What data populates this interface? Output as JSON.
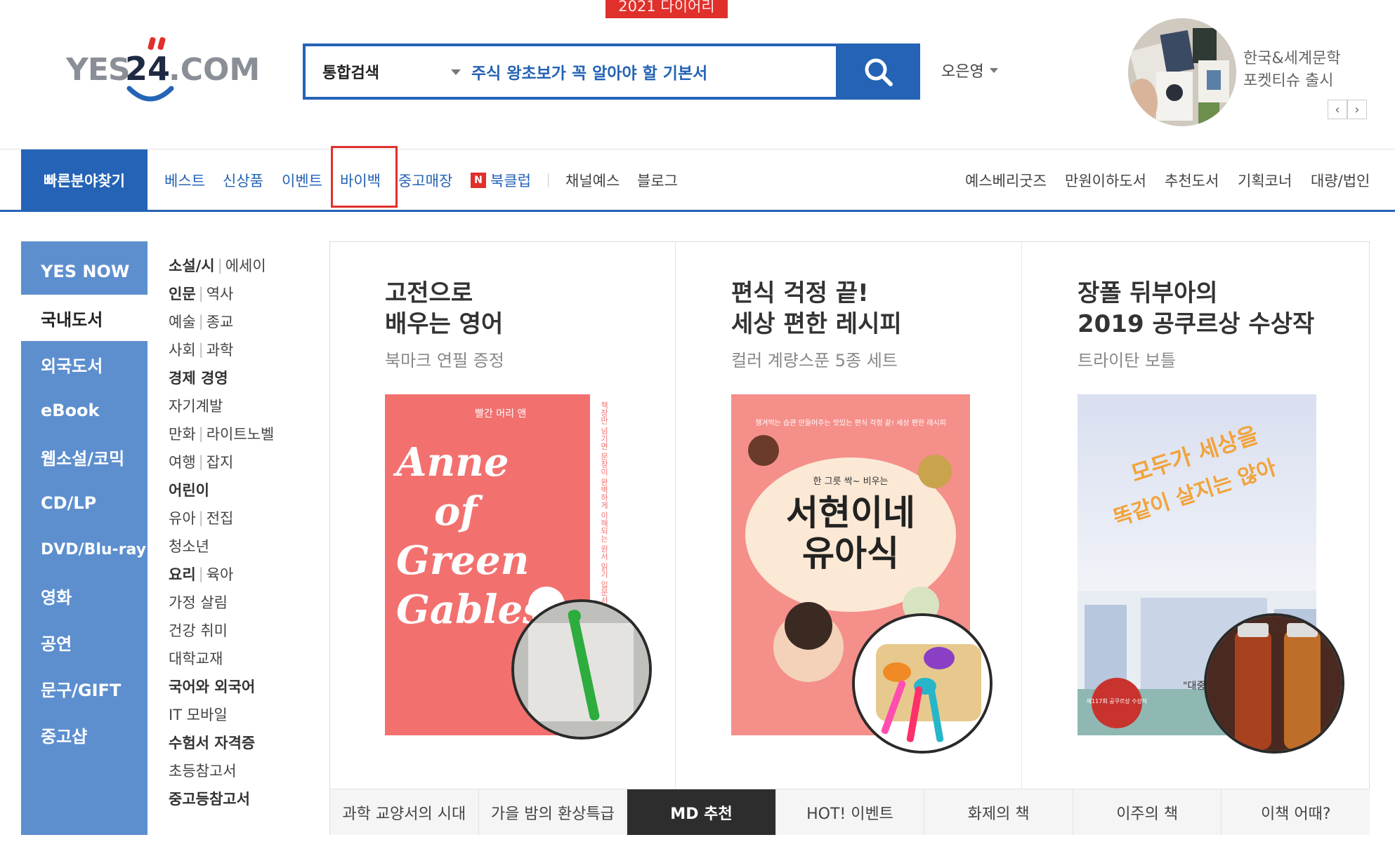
{
  "header": {
    "top_banner": "2021 다이어리",
    "logo_text": "YES24.COM",
    "search": {
      "category": "통합검색",
      "query": "주식 왕초보가 꼭 알아야 할 기본서"
    },
    "user_name": "오은영",
    "promo": {
      "line1": "한국&세계문학",
      "line2": "포켓티슈 출시",
      "prev": "‹",
      "next": "›"
    }
  },
  "nav": {
    "quick_find": "빠른분야찾기",
    "left_items": [
      "베스트",
      "신상품",
      "이벤트",
      "바이백",
      "중고매장",
      "북클럽",
      "채널예스",
      "블로그"
    ],
    "book_club_badge": "N",
    "right_items": [
      "예스베리굿즈",
      "만원이하도서",
      "추천도서",
      "기획코너",
      "대량/법인"
    ]
  },
  "categories": [
    "YES NOW",
    "국내도서",
    "외국도서",
    "eBook",
    "웹소설/코믹",
    "CD/LP",
    "DVD/Blu-ray",
    "영화",
    "공연",
    "문구/GIFT",
    "중고샵"
  ],
  "subcategories": [
    {
      "a": "소설/시",
      "b": "에세이",
      "bold": true
    },
    {
      "a": "인문",
      "b": "역사",
      "bold": true
    },
    {
      "a": "예술",
      "b": "종교",
      "bold": false
    },
    {
      "a": "사회",
      "b": "과학",
      "bold": false
    },
    {
      "a": "경제 경영",
      "b": "",
      "bold": true
    },
    {
      "a": "자기계발",
      "b": "",
      "bold": false
    },
    {
      "a": "만화",
      "b": "라이트노벨",
      "bold": false
    },
    {
      "a": "여행",
      "b": "잡지",
      "bold": false
    },
    {
      "a": "어린이",
      "b": "",
      "bold": true
    },
    {
      "a": "유아",
      "b": "전집",
      "bold": false
    },
    {
      "a": "청소년",
      "b": "",
      "bold": false
    },
    {
      "a": "요리",
      "b": "육아",
      "bold": true
    },
    {
      "a": "가정 살림",
      "b": "",
      "bold": false
    },
    {
      "a": "건강 취미",
      "b": "",
      "bold": false
    },
    {
      "a": "대학교재",
      "b": "",
      "bold": false
    },
    {
      "a": "국어와 외국어",
      "b": "",
      "bold": true
    },
    {
      "a": "IT 모바일",
      "b": "",
      "bold": false
    },
    {
      "a": "수험서 자격증",
      "b": "",
      "bold": true
    },
    {
      "a": "초등참고서",
      "b": "",
      "bold": false
    },
    {
      "a": "중고등참고서",
      "b": "",
      "bold": true
    }
  ],
  "features": [
    {
      "title": "고전으로\n배우는 영어",
      "subtitle": "북마크 연필 증정",
      "cover": {
        "small": "빨간 머리 앤",
        "big": [
          "Anne",
          "of",
          "Green",
          "Gables"
        ],
        "side": "책장만 넘기면 문장이 완벽하게 이해되는 원서 읽기 입문서"
      },
      "cover_color": "#f2716f"
    },
    {
      "title": "편식 걱정 끝!\n세상 편한 레시피",
      "subtitle": "컬러 계량스푼 5종 세트",
      "cover": {
        "top": "챙겨먹는 습관 만들어주는 맛있는 편식 걱정 끝! 세상 편한 레시피",
        "mid": "한 그릇 싹~ 비우는",
        "big1": "서현이네",
        "big2": "유아식"
      },
      "cover_color": "#f58f8a"
    },
    {
      "title": "장폴 뒤부아의\n2019 공쿠르상 수상작",
      "subtitle": "트라이탄 보틀",
      "cover": {
        "big1": "모두가 세상을",
        "big2": "똑같이 살지는 않아",
        "seal": "제117회 공쿠르상 수상작",
        "quote": "\"대중성과 모\""
      },
      "cover_color": "#eaeef5"
    }
  ],
  "tabs": [
    "과학 교양서의 시대",
    "가을 밤의 환상특급",
    "MD 추천",
    "HOT! 이벤트",
    "화제의 책",
    "이주의 책",
    "이책 어때?"
  ],
  "active_tab": "MD 추천",
  "colors": {
    "brand_blue": "#2463b5",
    "category_blue": "#5d8fcf",
    "red": "#e0302b"
  }
}
